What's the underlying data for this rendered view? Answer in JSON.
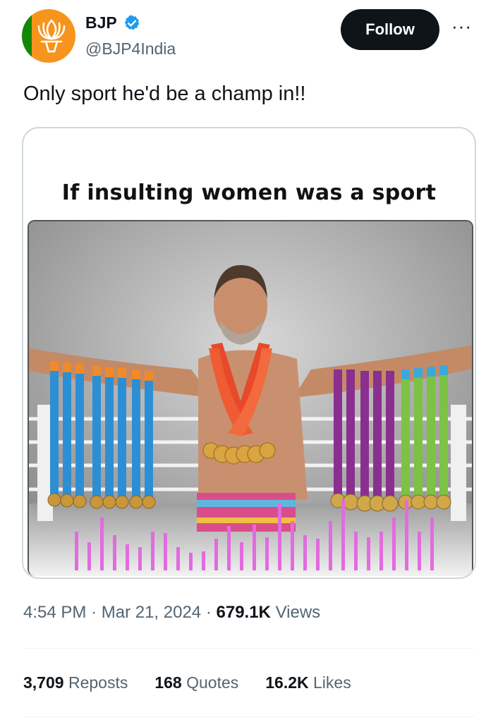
{
  "account": {
    "display_name": "BJP",
    "handle": "@BJP4India",
    "verified": true,
    "avatar_icon": "lotus-logo-icon",
    "avatar_colors": {
      "saffron": "#f7941d",
      "green": "#138808"
    }
  },
  "actions": {
    "follow_label": "Follow",
    "more_icon": "more-dots-icon",
    "more_label": "···"
  },
  "tweet": {
    "text": "Only sport he'd be a champ in!!",
    "media": {
      "caption": "If insulting women was a sport"
    }
  },
  "meta": {
    "time": "4:54 PM",
    "separator": "·",
    "date": "Mar 21, 2024",
    "views_count": "679.1K",
    "views_label": "Views"
  },
  "stats": {
    "reposts_count": "3,709",
    "reposts_label": "Reposts",
    "quotes_count": "168",
    "quotes_label": "Quotes",
    "likes_count": "16.2K",
    "likes_label": "Likes"
  },
  "colors": {
    "text_primary": "#0f1419",
    "text_secondary": "#536471",
    "verified_blue": "#1d9bf0",
    "border": "#cfd9de"
  }
}
